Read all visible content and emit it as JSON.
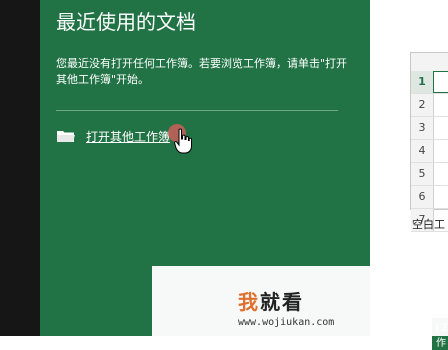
{
  "backstage": {
    "title": "最近使用的文档",
    "description": "您最近没有打开任何工作簿。若要浏览工作簿，请单击\"打开其他工作簿\"开始。",
    "open_other_label": "打开其他工作簿",
    "colors": {
      "panel": "#217346",
      "accent": "#ffffff"
    }
  },
  "templates": {
    "row_numbers": [
      "1",
      "2",
      "3",
      "4",
      "5",
      "6",
      "7"
    ],
    "blank_workbook_label": "空白工",
    "footer_label": "[工作"
  },
  "watermark": {
    "text_accent": "我",
    "text_rest": "就看",
    "url": "www.wojiukan.com"
  }
}
